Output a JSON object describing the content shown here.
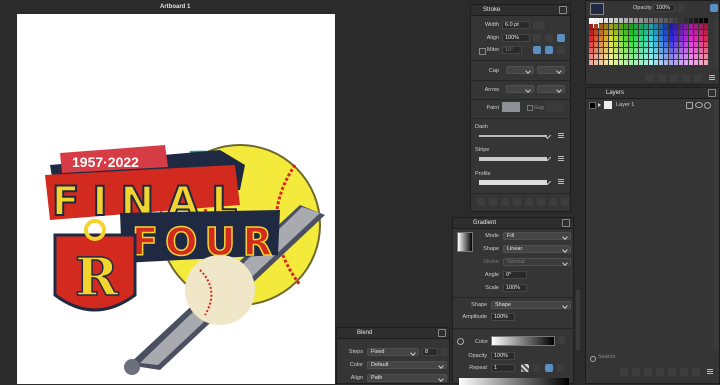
{
  "document": {
    "artboard_title": "Artboard 1"
  },
  "stroke_panel": {
    "title": "Stroke",
    "width_label": "Width",
    "width_value": "6.0 pt",
    "align_label": "Align",
    "align_value": "100%",
    "miter_label": "Miter",
    "miter_value": "10°",
    "cap_label": "Cap",
    "arrow_label": "Arrow",
    "paint_label": "Paint",
    "gap_label": "Gap",
    "dash_label": "Dash",
    "stripe_label": "Stripe",
    "profile_label": "Profile"
  },
  "color_panel": {
    "opacity_label": "Opacity",
    "opacity_value": "100%"
  },
  "layers_panel": {
    "title": "Layers",
    "layer_name": "Layer 1",
    "search_placeholder": "Search"
  },
  "gradient_panel": {
    "title": "Gradient",
    "mode_label": "Mode",
    "mode_value": "Fill",
    "shape_label": "Shape",
    "shape_value": "Linear",
    "stroke_label": "Stroke",
    "stroke_value": "Normal",
    "angle_label": "Angle",
    "angle_value": "0°",
    "scale_label": "Scale",
    "scale_value": "100%",
    "shape2_label": "Shape",
    "shape2_value": "Shape",
    "amplitude_label": "Amplitude",
    "amplitude_value": "100%",
    "color_label": "Color",
    "opacity_label": "Opacity",
    "opacity_value": "100%",
    "repeat_label": "Repeat",
    "repeat_value": "1"
  },
  "blend_panel": {
    "title": "Blend",
    "steps_label": "Steps",
    "steps_mode": "Fixed",
    "steps_value": "8",
    "color_label": "Color",
    "color_value": "Default",
    "align_label": "Align",
    "align_value": "Path"
  },
  "artwork": {
    "years": "1957·2022",
    "line1": "FINAL",
    "line2": "FOUR",
    "monogram": "R"
  }
}
